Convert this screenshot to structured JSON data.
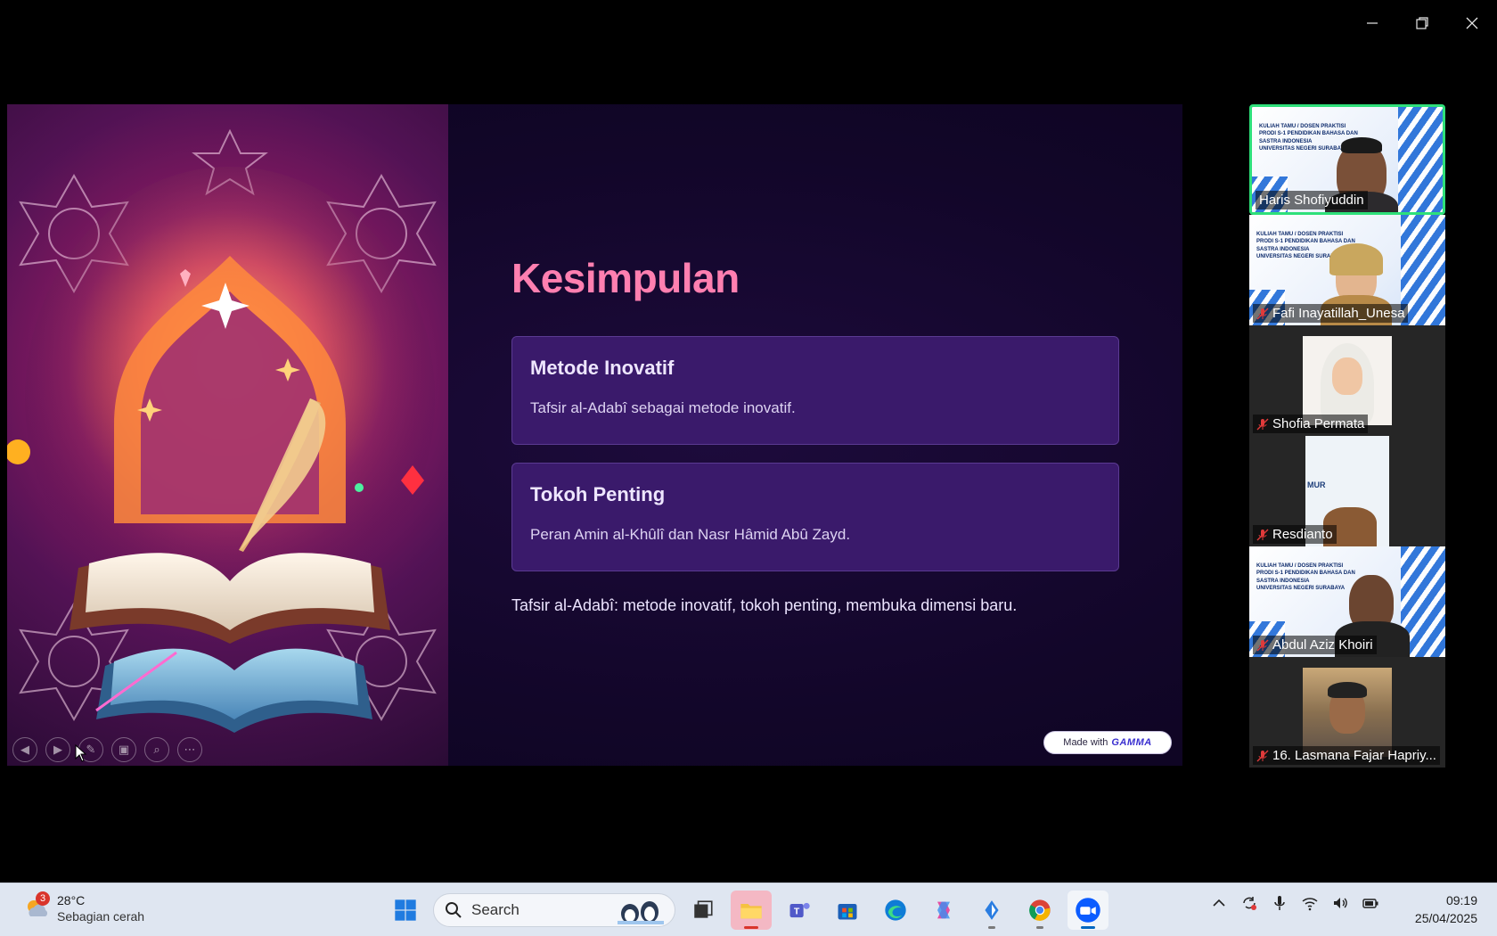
{
  "window": {
    "controls": [
      "minimize",
      "restore",
      "close"
    ]
  },
  "slide": {
    "title": "Kesimpulan",
    "cards": [
      {
        "title": "Metode Inovatif",
        "body": "Tafsir al-Adabî sebagai metode inovatif."
      },
      {
        "title": "Tokoh Penting",
        "body": "Peran Amin al-Khûlî dan Nasr Hâmid Abû Zayd."
      }
    ],
    "summary": "Tafsir al-Adabî: metode inovatif, tokoh penting, membuka dimensi baru.",
    "badge": {
      "prefix": "Made with",
      "brand": "GAMMA"
    },
    "toolbar": [
      "prev",
      "next",
      "pen",
      "slides",
      "zoom",
      "more"
    ],
    "colors": {
      "title": "#ff7fb0",
      "card": "#3a1a6b",
      "background": "#120629"
    }
  },
  "participants": [
    {
      "name": "Haris Shofiyuddin",
      "muted": false,
      "active": true,
      "kind": "poster"
    },
    {
      "name": "Fafi Inayatillah_Unesa",
      "muted": true,
      "active": false,
      "kind": "poster"
    },
    {
      "name": "Shofia Permata",
      "muted": true,
      "active": false,
      "kind": "photo"
    },
    {
      "name": "Resdianto",
      "muted": true,
      "active": false,
      "kind": "photo"
    },
    {
      "name": "Abdul Aziz Khoiri",
      "muted": true,
      "active": false,
      "kind": "poster"
    },
    {
      "name": "16. Lasmana Fajar Hapriy...",
      "muted": true,
      "active": false,
      "kind": "photo"
    }
  ],
  "poster_text": {
    "line1": "KULIAH TAMU / DOSEN PRAKTISI",
    "line2": "PRODI S-1 PENDIDIKAN BAHASA DAN SASTRA INDONESIA",
    "line3": "UNIVERSITAS NEGERI SURABAYA"
  },
  "resdianto_poster": "MUR",
  "taskbar": {
    "weather": {
      "badge": "3",
      "temp": "28°C",
      "condition": "Sebagian cerah"
    },
    "search_placeholder": "Search",
    "apps": [
      "start",
      "search",
      "task-view",
      "file-explorer",
      "teams",
      "store",
      "edge",
      "copilot",
      "app-blue",
      "chrome",
      "zoom"
    ],
    "active_app": "zoom",
    "clock": {
      "time": "09:19",
      "date": "25/04/2025"
    }
  }
}
